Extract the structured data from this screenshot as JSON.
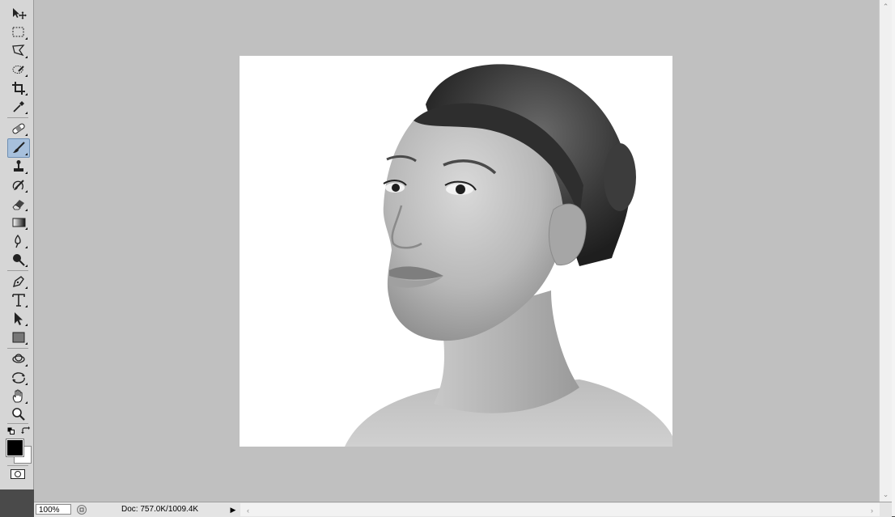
{
  "toolbar": {
    "tools": [
      {
        "name": "move-tool",
        "icon": "move-icon"
      },
      {
        "name": "rectangular-marquee-tool",
        "icon": "marquee-icon"
      },
      {
        "name": "polygonal-lasso-tool",
        "icon": "lasso-icon"
      },
      {
        "name": "quick-selection-tool",
        "icon": "quick-selection-icon"
      },
      {
        "name": "crop-tool",
        "icon": "crop-icon"
      },
      {
        "name": "eyedropper-tool",
        "icon": "eyedropper-icon"
      },
      {
        "name": "healing-brush-tool",
        "icon": "bandage-icon"
      },
      {
        "name": "brush-tool",
        "icon": "brush-icon",
        "active": true
      },
      {
        "name": "clone-stamp-tool",
        "icon": "stamp-icon"
      },
      {
        "name": "history-brush-tool",
        "icon": "history-brush-icon"
      },
      {
        "name": "eraser-tool",
        "icon": "eraser-icon"
      },
      {
        "name": "gradient-tool",
        "icon": "gradient-icon"
      },
      {
        "name": "blur-tool",
        "icon": "blur-icon"
      },
      {
        "name": "dodge-tool",
        "icon": "dodge-icon"
      },
      {
        "name": "pen-tool",
        "icon": "pen-icon"
      },
      {
        "name": "type-tool",
        "icon": "type-icon",
        "glyph": "T"
      },
      {
        "name": "path-selection-tool",
        "icon": "arrow-icon"
      },
      {
        "name": "rectangle-shape-tool",
        "icon": "rectangle-icon"
      },
      {
        "name": "3d-rotate-tool",
        "icon": "3d-rotate-icon"
      },
      {
        "name": "3d-orbit-tool",
        "icon": "3d-orbit-icon"
      },
      {
        "name": "hand-tool",
        "icon": "hand-icon"
      },
      {
        "name": "zoom-tool",
        "icon": "magnifier-icon"
      }
    ],
    "foreground_color": "#000000",
    "background_color": "#ffffff"
  },
  "canvas": {
    "background": "#c0c0c0",
    "document_image": "grayscale portrait of a woman looking upward"
  },
  "statusbar": {
    "zoom": "100%",
    "doc_info": "Doc: 757.0K/1009.4K"
  }
}
